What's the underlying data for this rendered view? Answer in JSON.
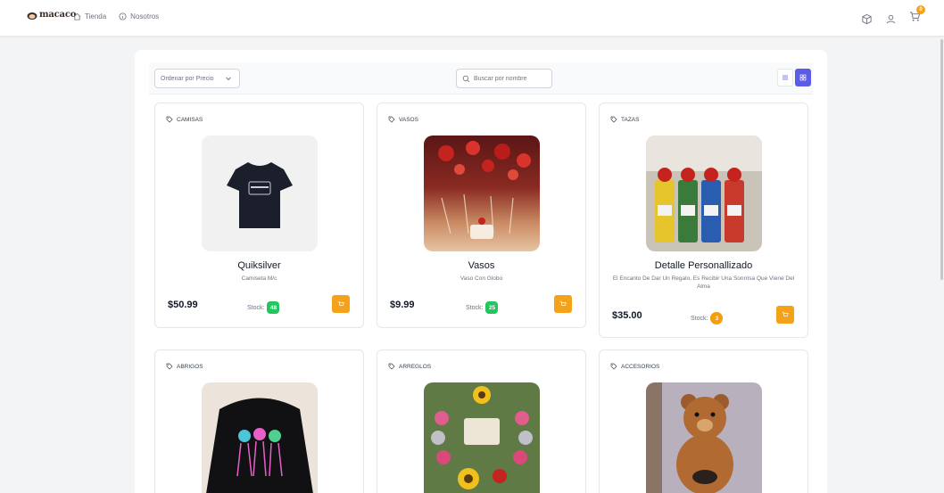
{
  "header": {
    "logo_text": "macaco",
    "nav": [
      {
        "label": "Tienda",
        "icon": "home-icon"
      },
      {
        "label": "Nosotros",
        "icon": "info-icon"
      }
    ],
    "cart_count": "0"
  },
  "toolbar": {
    "sort_label": "Ordenar por Precio",
    "search_placeholder": "Buscar por nombre"
  },
  "products": [
    {
      "category": "CAMISAS",
      "title": "Quiksilver",
      "subtitle": "Camiseta M/c",
      "price": "$50.99",
      "stock_label": "Stock:",
      "stock": "48",
      "stock_color": "#22c55e"
    },
    {
      "category": "VASOS",
      "title": "Vasos",
      "subtitle": "Vaso Con Globo",
      "price": "$9.99",
      "stock_label": "Stock:",
      "stock": "25",
      "stock_color": "#22c55e"
    },
    {
      "category": "TAZAS",
      "title": "Detalle Personallizado",
      "subtitle": "El Encanto De Dar Un Regalo, Es Recibir Una Sonrrisa Que Viene Del Alma",
      "price": "$35.00",
      "stock_label": "Stock:",
      "stock": "3",
      "stock_color": "#f59e0b"
    },
    {
      "category": "ABRIGOS"
    },
    {
      "category": "ARREGLOS"
    },
    {
      "category": "ACCESORIOS"
    }
  ],
  "colors": {
    "accent": "#f5a21b",
    "grid_toggle": "#5b5be8",
    "stock_ok": "#22c55e",
    "stock_low": "#f59e0b"
  }
}
